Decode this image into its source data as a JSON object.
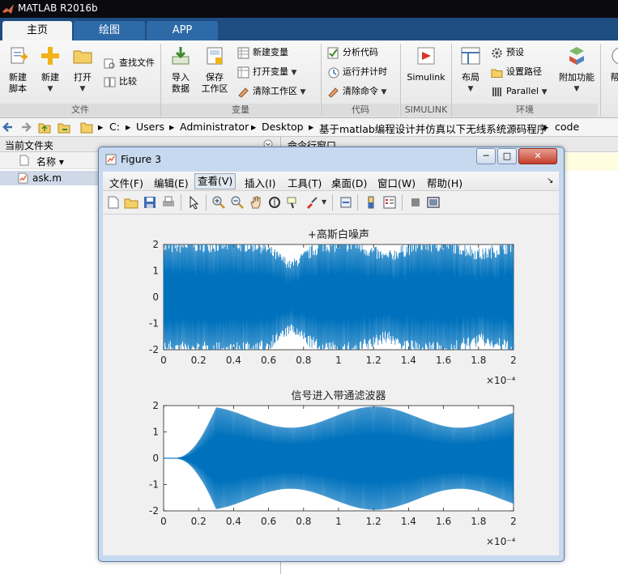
{
  "app": {
    "title": "MATLAB R2016b"
  },
  "tabs": [
    {
      "label": "主页"
    },
    {
      "label": "绘图"
    },
    {
      "label": "APP"
    }
  ],
  "ribbon": {
    "file": {
      "new_script": "新建\n脚本",
      "new": "新建",
      "open": "打开",
      "find_files": "查找文件",
      "compare": "比较",
      "group": "文件"
    },
    "variable": {
      "import": "导入\n数据",
      "save": "保存\n工作区",
      "new_var": "新建变量",
      "open_var": "打开变量",
      "clear_ws": "清除工作区",
      "group": "变量"
    },
    "code": {
      "analyze": "分析代码",
      "run_time": "运行并计时",
      "clear_cmd": "清除命令",
      "group": "代码"
    },
    "simulink": {
      "label": "Simulink",
      "group": "SIMULINK"
    },
    "env": {
      "layout": "布局",
      "prefs": "预设",
      "set_path": "设置路径",
      "parallel": "Parallel",
      "group": "环境"
    },
    "addons": {
      "label": "附加功能"
    },
    "help": {
      "label": "帮"
    }
  },
  "address": {
    "crumbs": [
      "C:",
      "Users",
      "Administrator",
      "Desktop",
      "基于matlab编程设计并仿真以下无线系统源码程序",
      "code"
    ]
  },
  "left_panel": {
    "title": "当前文件夹",
    "col_name": "名称 ▾",
    "file": "ask.m"
  },
  "right_panel": {
    "title": "命令行窗口"
  },
  "figure": {
    "title": "Figure 3",
    "menu": [
      "文件(F)",
      "编辑(E)",
      "查看(V)",
      "插入(I)",
      "工具(T)",
      "桌面(D)",
      "窗口(W)",
      "帮助(H)"
    ]
  },
  "chart_data": [
    {
      "type": "line",
      "title": "+高斯白噪声",
      "xlim": [
        0,
        0.0002
      ],
      "ylim": [
        -2,
        2
      ],
      "xticks": [
        "0",
        "0.2",
        "0.4",
        "0.6",
        "0.8",
        "1",
        "1.2",
        "1.4",
        "1.6",
        "1.8",
        "2"
      ],
      "yticks": [
        "2",
        "1",
        "0",
        "-1",
        "-2"
      ],
      "x_exponent": "×10⁻⁴",
      "series": [
        {
          "color": "#0072bd",
          "description_envelope": [
            0.95,
            1.0,
            1.0,
            1.0,
            0.6,
            1.0,
            1.0,
            0.75,
            1.0,
            1.0,
            0.8,
            1.0
          ]
        }
      ]
    },
    {
      "type": "line",
      "title": "信号进入带通滤波器",
      "xlim": [
        0,
        0.0002
      ],
      "ylim": [
        -2,
        2
      ],
      "xticks": [
        "0",
        "0.2",
        "0.4",
        "0.6",
        "0.8",
        "1",
        "1.2",
        "1.4",
        "1.6",
        "1.8",
        "2"
      ],
      "yticks": [
        "2",
        "1",
        "0",
        "-1",
        "-2"
      ],
      "x_exponent": "×10⁻⁴",
      "series": [
        {
          "color": "#0072bd"
        }
      ]
    }
  ]
}
